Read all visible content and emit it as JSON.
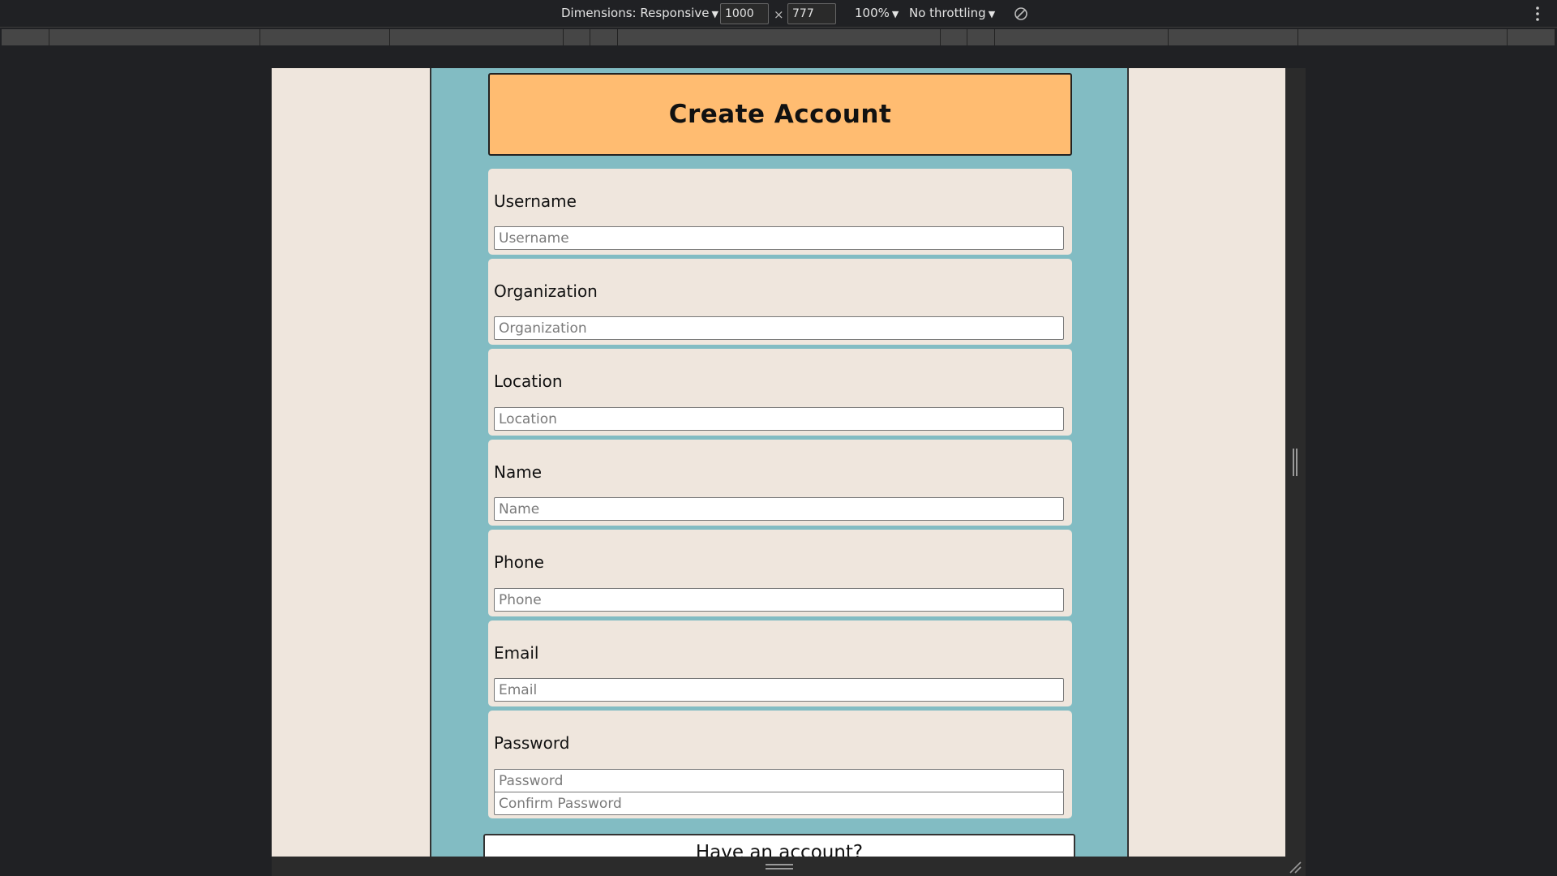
{
  "devtools": {
    "dimensions_label": "Dimensions: Responsive",
    "width_value": "1000",
    "times_sign": "×",
    "height_value": "777",
    "zoom_label": "100%",
    "throttling_label": "No throttling",
    "dropdown_arrow": "▼"
  },
  "form": {
    "title": "Create Account",
    "fields": [
      {
        "label": "Username",
        "placeholder": "Username"
      },
      {
        "label": "Organization",
        "placeholder": "Organization"
      },
      {
        "label": "Location",
        "placeholder": "Location"
      },
      {
        "label": "Name",
        "placeholder": "Name"
      },
      {
        "label": "Phone",
        "placeholder": "Phone"
      },
      {
        "label": "Email",
        "placeholder": "Email"
      },
      {
        "label": "Password",
        "placeholder": "Password",
        "confirm_placeholder": "Confirm Password"
      }
    ],
    "have_account_label": "Have an account?"
  },
  "colors": {
    "page_background": "#efe6dd",
    "column_background": "#82bcc3",
    "title_background": "#ffbc71",
    "devtools_background": "#202124"
  }
}
